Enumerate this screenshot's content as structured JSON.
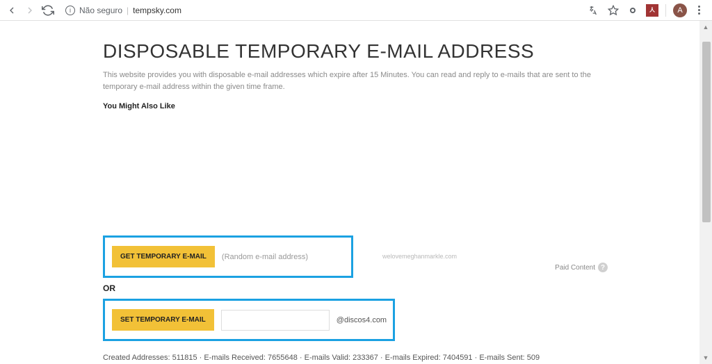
{
  "browser": {
    "security_label": "Não seguro",
    "url": "tempsky.com",
    "avatar_letter": "A"
  },
  "page": {
    "title": "DISPOSABLE TEMPORARY E-MAIL ADDRESS",
    "description": "This website provides you with disposable e-mail addresses which expire after 15 Minutes. You can read and reply to e-mails that are sent to the temporary e-mail address within the given time frame.",
    "you_might_also_like": "You Might Also Like",
    "ad_caption": "welovemeghanmarkle.com",
    "paid_content": "Paid Content"
  },
  "actions": {
    "get_button": "GET TEMPORARY E-MAIL",
    "get_hint": "(Random e-mail address)",
    "or": "OR",
    "set_button": "SET TEMPORARY E-MAIL",
    "email_input": "",
    "domain_suffix": "@discos4.com"
  },
  "stats": {
    "line": "Created Addresses: 511815 · E-mails Received: 7655648 · E-mails Valid: 233367 · E-mails Expired: 7404591 · E-mails Sent: 509"
  }
}
